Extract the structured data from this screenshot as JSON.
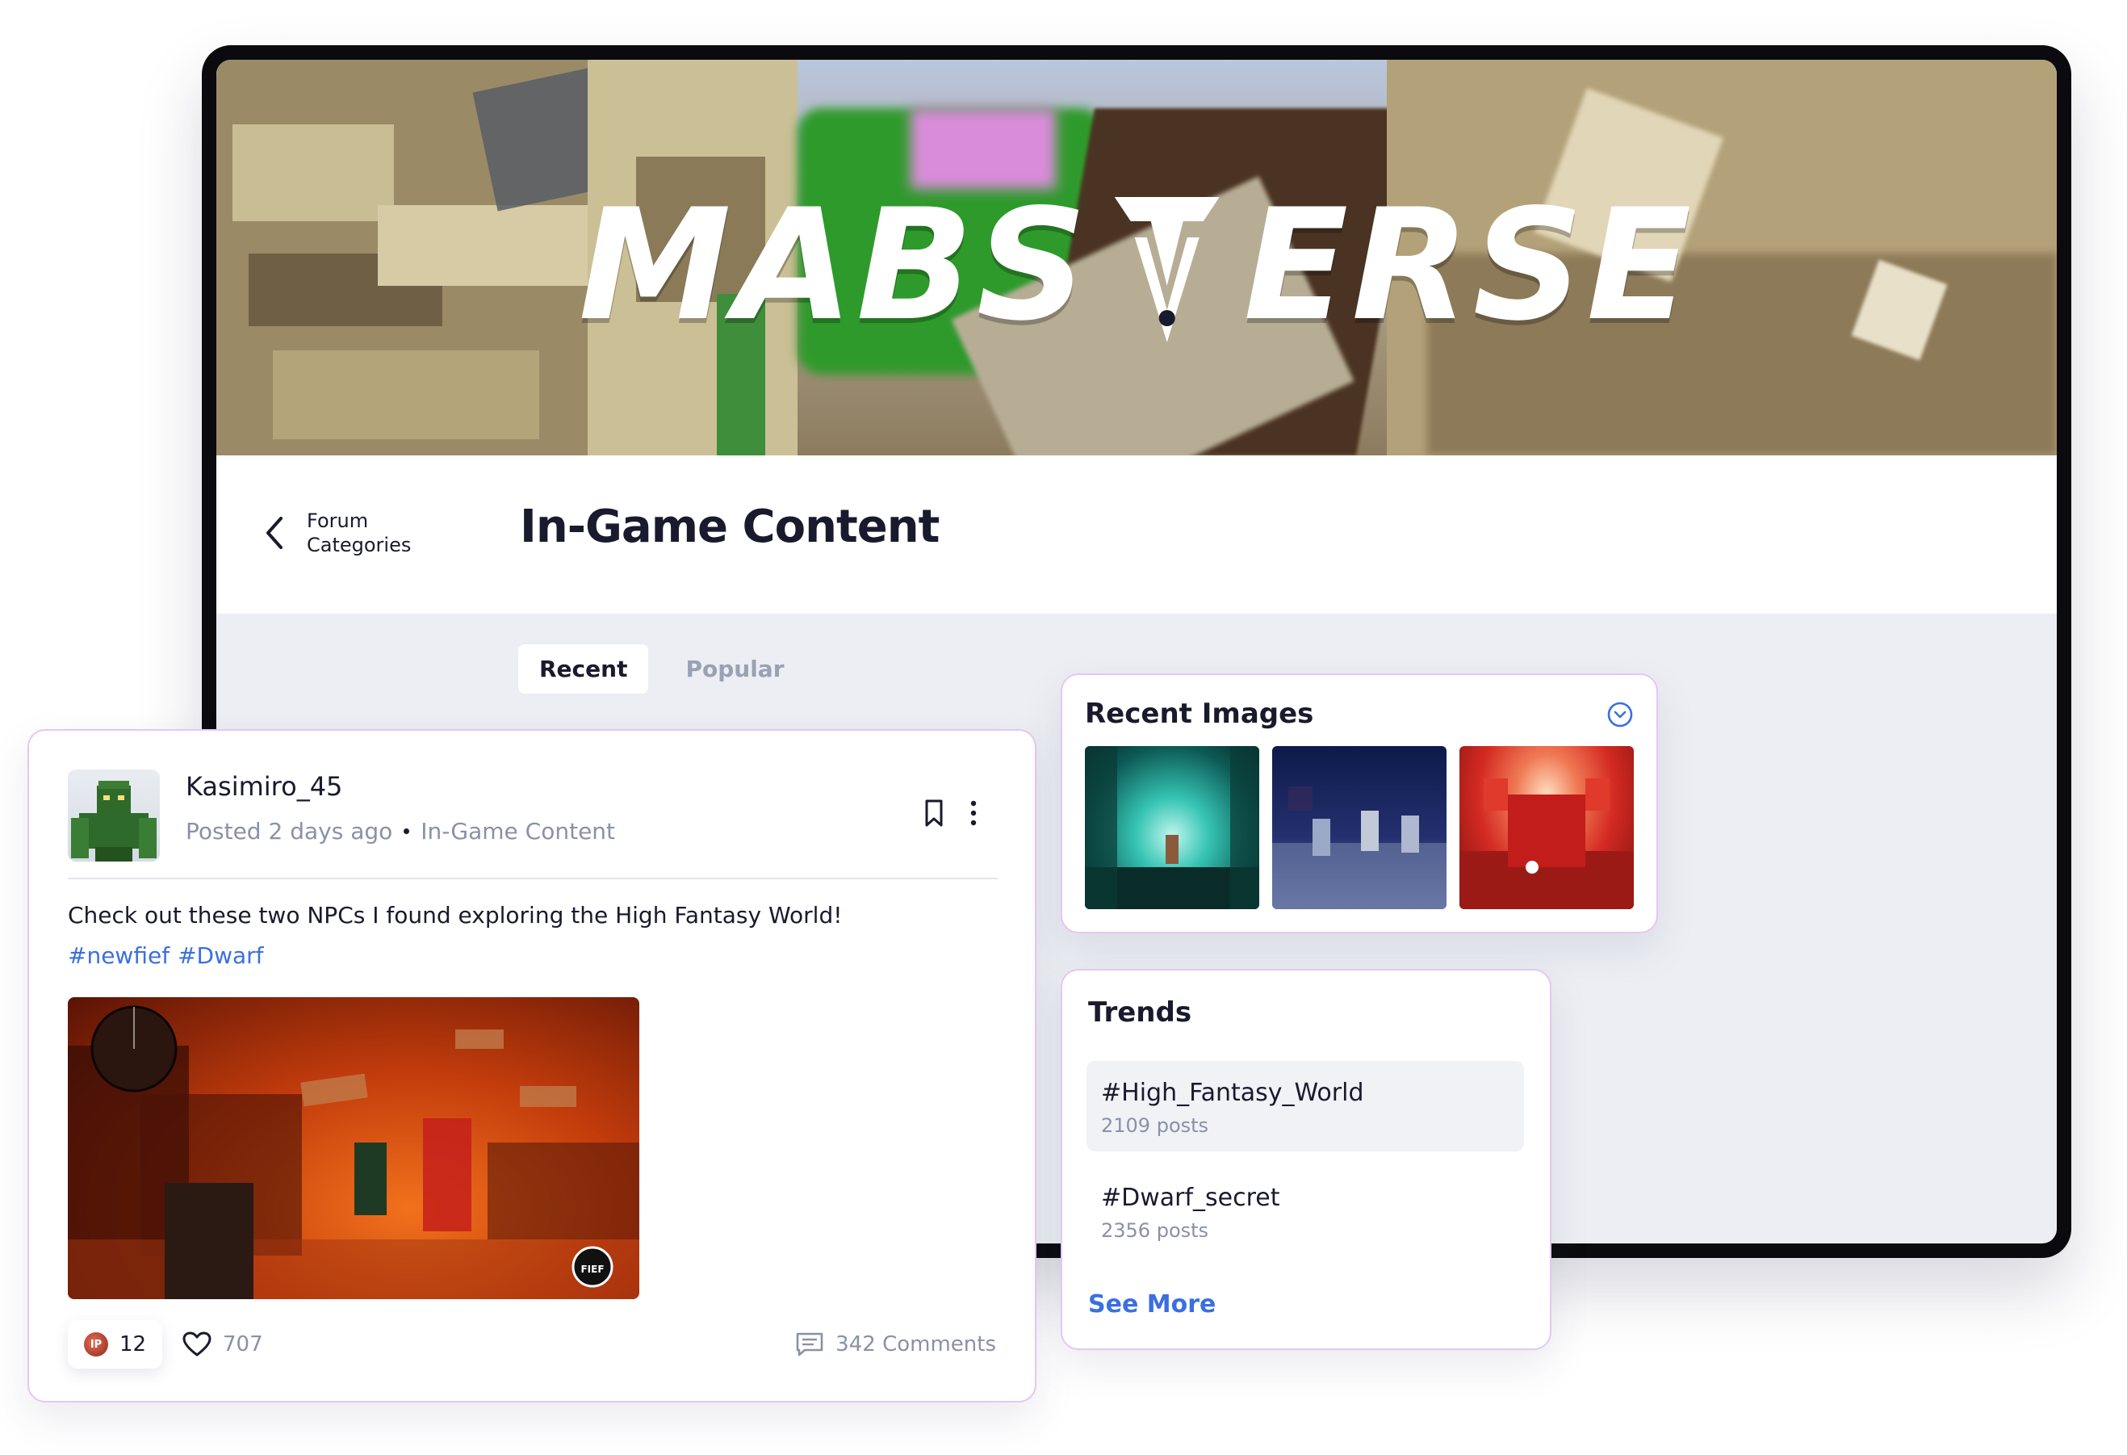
{
  "banner": {
    "logo_left": "MABS",
    "logo_right": "ERSE"
  },
  "header": {
    "back_label": "Forum Categories",
    "title": "In-Game Content"
  },
  "tabs": [
    {
      "label": "Recent",
      "active": true
    },
    {
      "label": "Popular",
      "active": false
    }
  ],
  "post": {
    "author": "Kasimiro_45",
    "posted": "Posted 2 days ago",
    "category": "In-Game Content",
    "text": "Check out these two NPCs I found exploring the High Fantasy World!",
    "hashtags": [
      "#newfief",
      "#Dwarf"
    ],
    "image_badge": "FIEF",
    "coin_label": "IP",
    "reactions": "12",
    "likes": "707",
    "comments": "342 Comments"
  },
  "recent_images": {
    "title": "Recent Images",
    "thumbs": [
      "teal cave with character",
      "night scene with knights",
      "red dragon scene"
    ]
  },
  "trends": {
    "title": "Trends",
    "items": [
      {
        "tag": "#High_Fantasy_World",
        "count": "2109 posts",
        "active": true
      },
      {
        "tag": "#Dwarf_secret",
        "count": "2356 posts",
        "active": false
      }
    ],
    "see_more": "See More"
  },
  "colors": {
    "accent": "#3b6fe0",
    "card_border": "#e6c6f3",
    "muted": "#8a91a7",
    "text": "#1a1a2e",
    "screen_bg": "#eceef3"
  }
}
